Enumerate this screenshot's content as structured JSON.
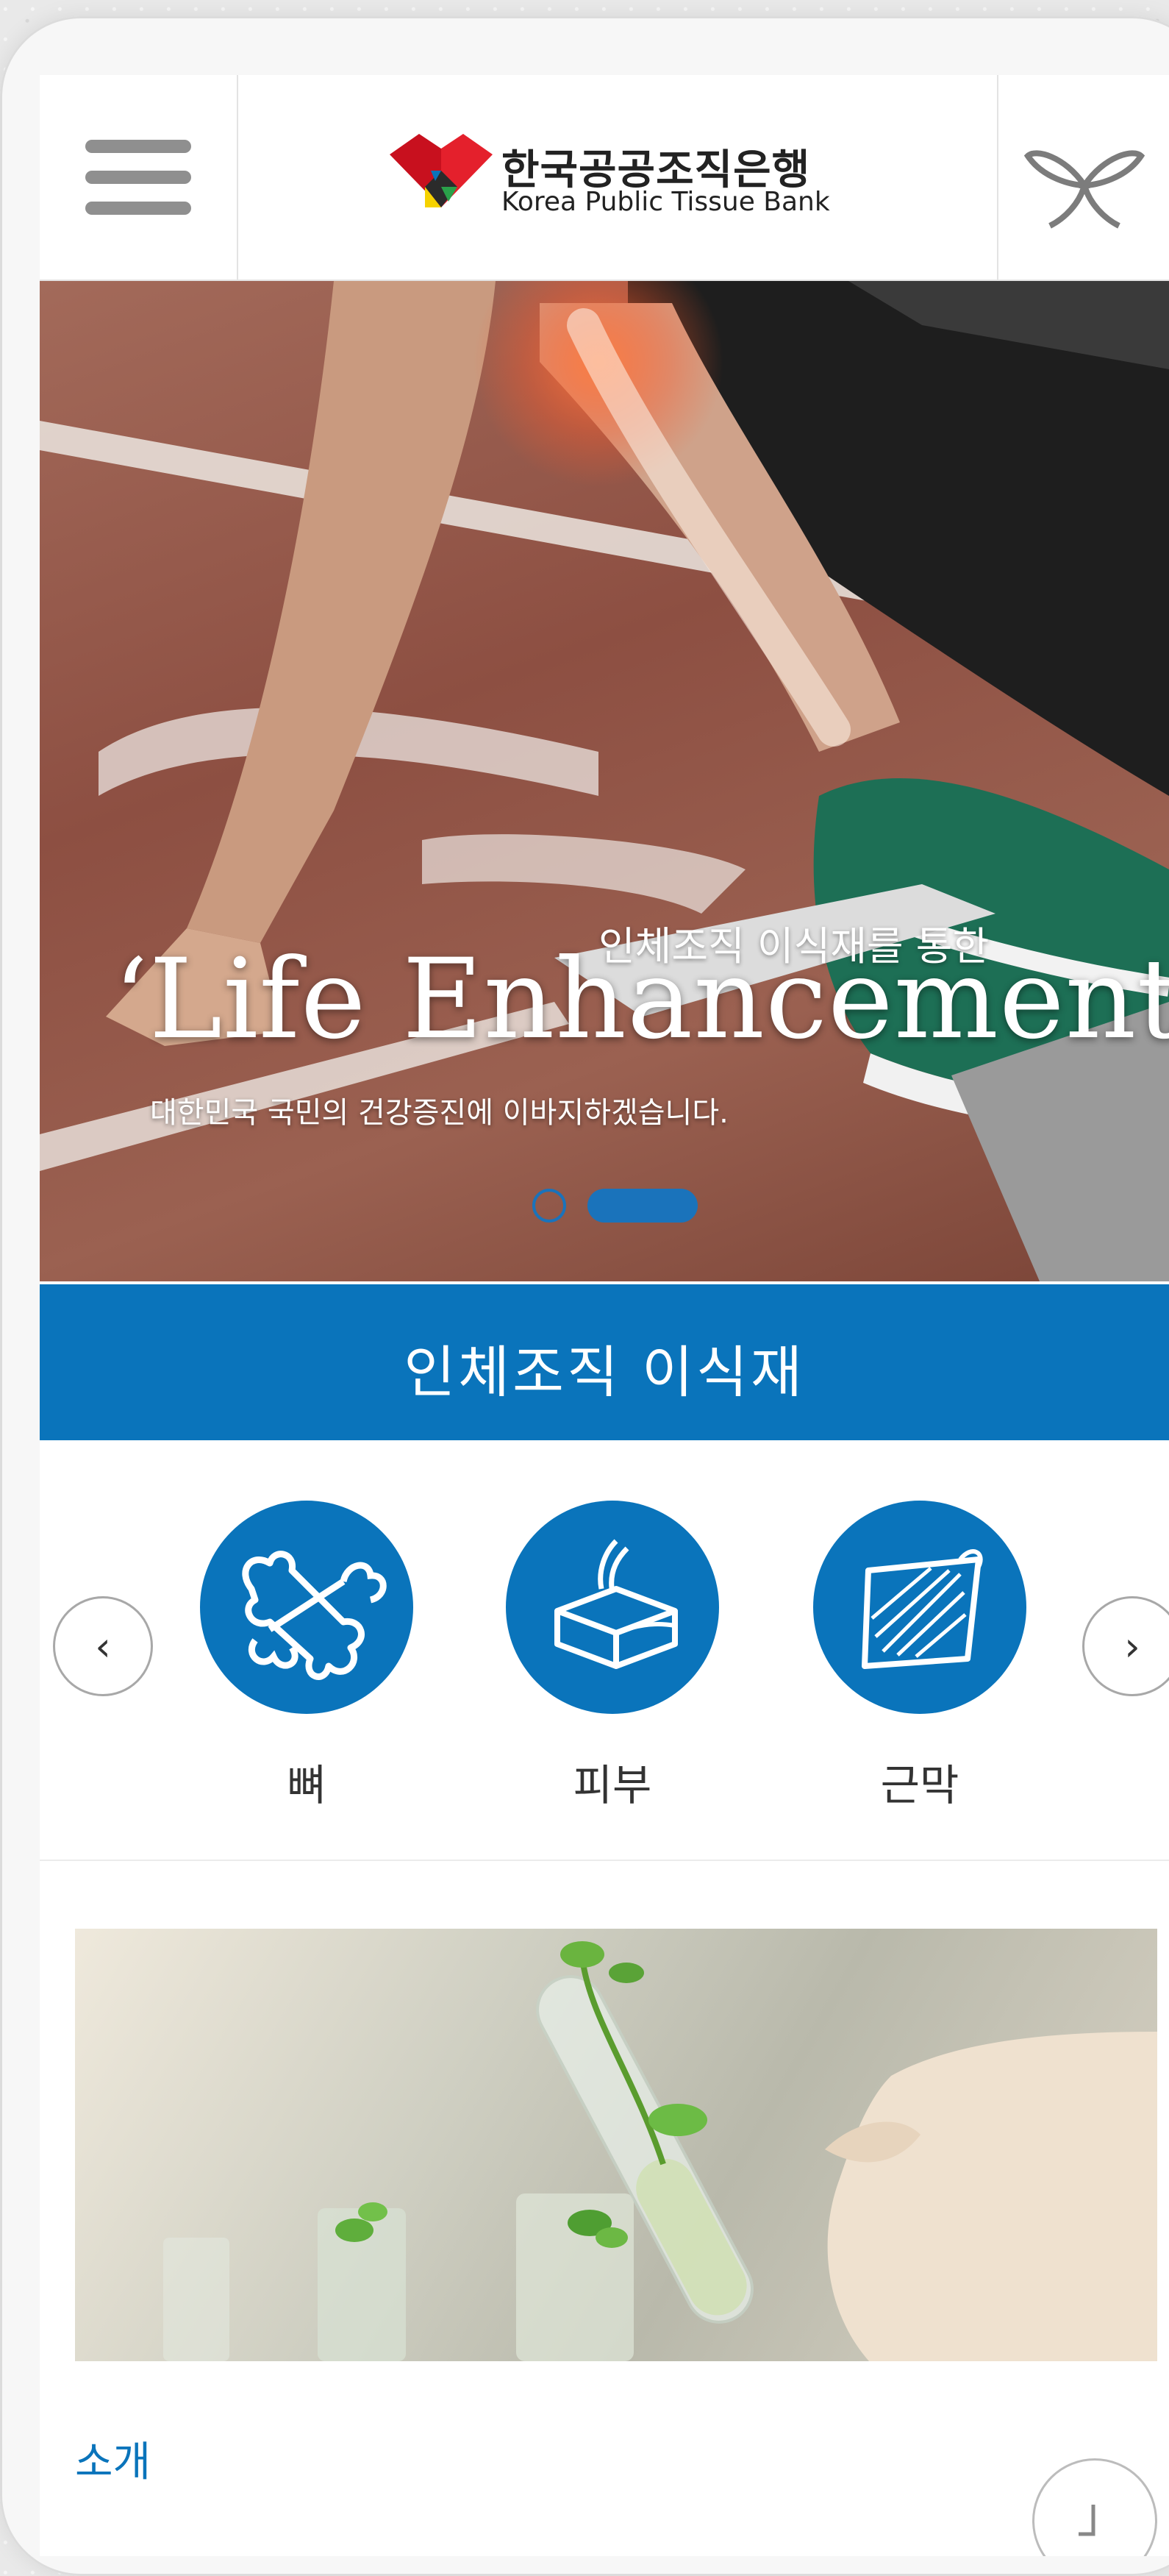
{
  "header": {
    "logo_ko": "한국공공조직은행",
    "logo_en": "Korea Public Tissue Bank"
  },
  "hero": {
    "subtitle": "인체조직 이식재를 통한",
    "title": "‘Life Enhancement’",
    "description": "대한민국 국민의 건강증진에 이바지하겠습니다.",
    "slide_count": 2,
    "active_slide": 2
  },
  "section": {
    "title": "인체조직 이식재"
  },
  "categories": [
    {
      "label": "뼈",
      "icon": "bone-icon"
    },
    {
      "label": "피부",
      "icon": "skin-icon"
    },
    {
      "label": "근막",
      "icon": "fascia-icon"
    }
  ],
  "intro": {
    "label": "소개"
  },
  "colors": {
    "brand_blue": "#0a74bb",
    "logo_red": "#e4202c",
    "logo_yellow": "#f6d200",
    "logo_green": "#2aa14a"
  }
}
